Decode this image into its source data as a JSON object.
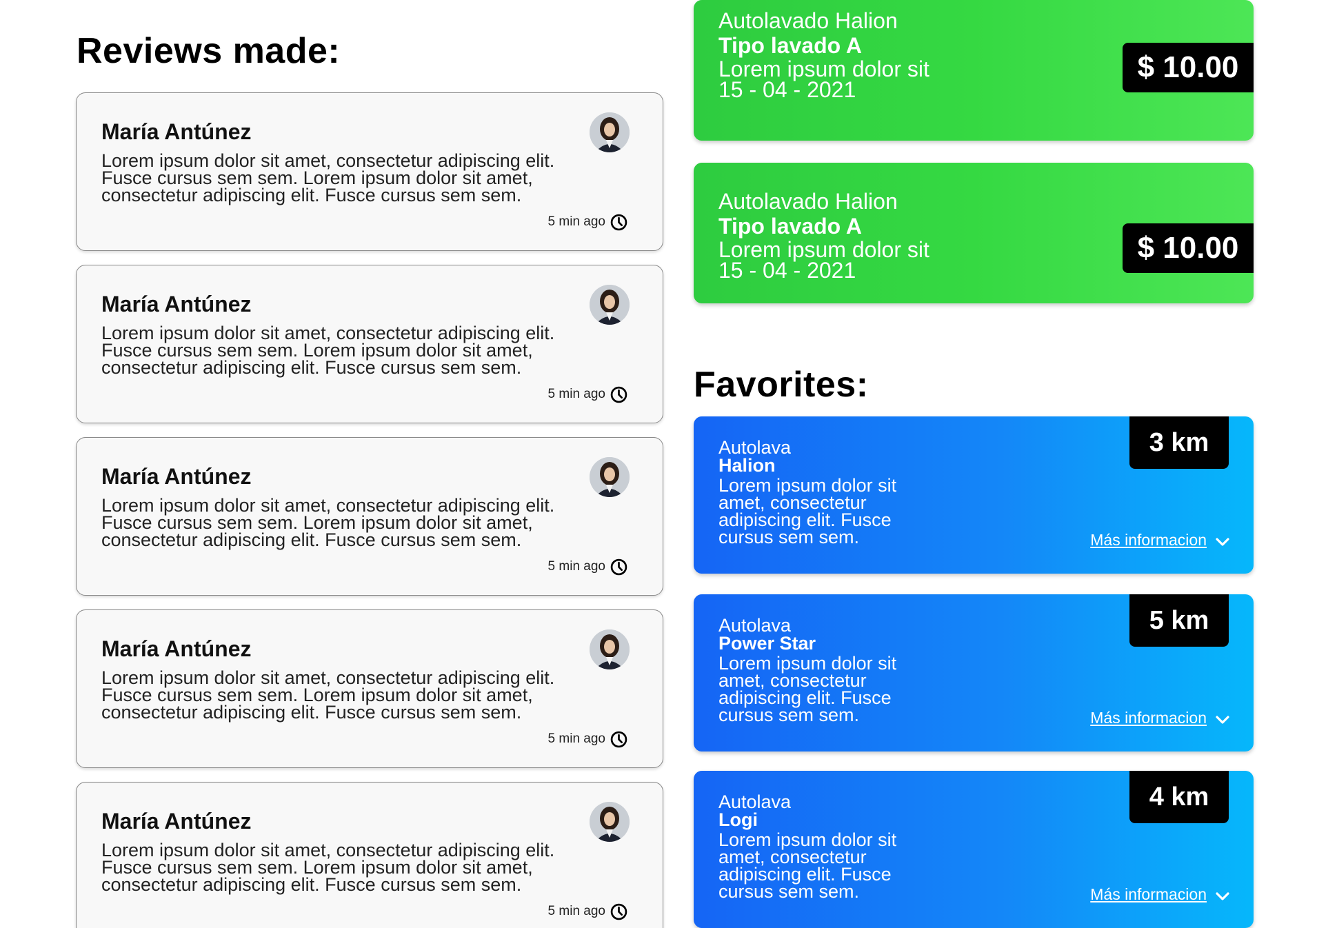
{
  "reviews": {
    "title": "Reviews made:",
    "items": [
      {
        "name": "María Antúnez",
        "text": "Lorem ipsum dolor sit amet, consectetur adipiscing elit. Fusce cursus sem sem. Lorem ipsum dolor sit amet, consectetur adipiscing elit. Fusce cursus sem sem.",
        "time": "5 min ago",
        "avatar_icon": "avatar-woman",
        "time_icon": "clock-icon"
      },
      {
        "name": "María Antúnez",
        "text": "Lorem ipsum dolor sit amet, consectetur adipiscing elit. Fusce cursus sem sem. Lorem ipsum dolor sit amet, consectetur adipiscing elit. Fusce cursus sem sem.",
        "time": "5 min ago",
        "avatar_icon": "avatar-woman",
        "time_icon": "clock-icon"
      },
      {
        "name": "María Antúnez",
        "text": "Lorem ipsum dolor sit amet, consectetur adipiscing elit. Fusce cursus sem sem. Lorem ipsum dolor sit amet, consectetur adipiscing elit. Fusce cursus sem sem.",
        "time": "5 min ago",
        "avatar_icon": "avatar-woman",
        "time_icon": "clock-icon"
      },
      {
        "name": "María Antúnez",
        "text": "Lorem ipsum dolor sit amet, consectetur adipiscing elit. Fusce cursus sem sem. Lorem ipsum dolor sit amet, consectetur adipiscing elit. Fusce cursus sem sem.",
        "time": "5 min ago",
        "avatar_icon": "avatar-woman",
        "time_icon": "clock-icon"
      },
      {
        "name": "María Antúnez",
        "text": "Lorem ipsum dolor sit amet, consectetur adipiscing elit. Fusce cursus sem sem. Lorem ipsum dolor sit amet, consectetur adipiscing elit. Fusce cursus sem sem.",
        "time": "5 min ago",
        "avatar_icon": "avatar-woman",
        "time_icon": "clock-icon"
      }
    ]
  },
  "washes": [
    {
      "place": "Autolavado Halion",
      "type": "Tipo lavado A",
      "desc": "Lorem ipsum dolor sit",
      "date": "15 - 04 - 2021",
      "price": "$ 10.00"
    },
    {
      "place": "Autolavado Halion",
      "type": "Tipo lavado A",
      "desc": "Lorem ipsum dolor sit",
      "date": "15 - 04 - 2021",
      "price": "$ 10.00"
    }
  ],
  "favorites": {
    "title": "Favorites:",
    "items": [
      {
        "prefix": "Autolava",
        "name": "Halion",
        "desc": "Lorem ipsum dolor sit amet, consectetur adipiscing elit. Fusce cursus sem sem.",
        "distance": "3 km",
        "more": "Más informacion",
        "more_icon": "chevron-down-icon"
      },
      {
        "prefix": "Autolava",
        "name": "Power Star",
        "desc": "Lorem ipsum dolor sit amet, consectetur adipiscing elit. Fusce cursus sem sem.",
        "distance": "5 km",
        "more": "Más informacion",
        "more_icon": "chevron-down-icon"
      },
      {
        "prefix": "Autolava",
        "name": "Logi",
        "desc": "Lorem ipsum dolor sit amet, consectetur adipiscing elit. Fusce cursus sem sem.",
        "distance": "4 km",
        "more": "Más informacion",
        "more_icon": "chevron-down-icon"
      }
    ]
  },
  "colors": {
    "wash_card_green": "#35d942",
    "favorite_card_blue": "#1487f8",
    "tag_black": "#000000",
    "review_card_bg": "#f8f8f8"
  }
}
